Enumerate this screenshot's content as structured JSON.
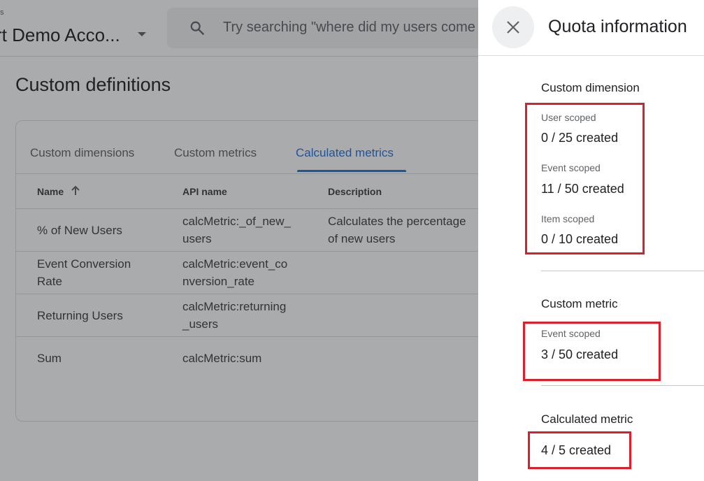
{
  "header": {
    "account_label": "s",
    "account_name": "rt Demo Acco...",
    "search_placeholder": "Try searching \"where did my users come from\""
  },
  "page": {
    "title": "Custom definitions"
  },
  "tabs": [
    {
      "label": "Custom dimensions",
      "active": false
    },
    {
      "label": "Custom metrics",
      "active": false
    },
    {
      "label": "Calculated metrics",
      "active": true
    }
  ],
  "table": {
    "columns": [
      "Name",
      "API name",
      "Description"
    ],
    "rows": [
      {
        "name": "% of New Users",
        "api": "calcMetric:_of_new_\nusers",
        "description": "Calculates the percentage\nof new users"
      },
      {
        "name": "Event Conversion\nRate",
        "api": "calcMetric:event_co\nnversion_rate",
        "description": ""
      },
      {
        "name": "Returning Users",
        "api": "calcMetric:returning\n_users",
        "description": ""
      },
      {
        "name": "Sum",
        "api": "calcMetric:sum",
        "description": ""
      }
    ]
  },
  "panel": {
    "title": "Quota information",
    "custom_dimension": {
      "title": "Custom dimension",
      "items": [
        {
          "label": "User scoped",
          "value": "0 / 25 created"
        },
        {
          "label": "Event scoped",
          "value": "11 / 50 created"
        },
        {
          "label": "Item scoped",
          "value": "0 / 10 created"
        }
      ]
    },
    "custom_metric": {
      "title": "Custom metric",
      "items": [
        {
          "label": "Event scoped",
          "value": "3 / 50 created"
        }
      ]
    },
    "calculated_metric": {
      "title": "Calculated metric",
      "value": "4 / 5 created"
    }
  },
  "colors": {
    "accent": "#1a73e8",
    "highlight": "#d9202b",
    "scrim": "rgba(32,33,36,0.38)"
  },
  "icons": {
    "search": "search-icon",
    "close": "close-icon",
    "sort": "arrow-up-icon",
    "caret": "caret-down-icon"
  }
}
